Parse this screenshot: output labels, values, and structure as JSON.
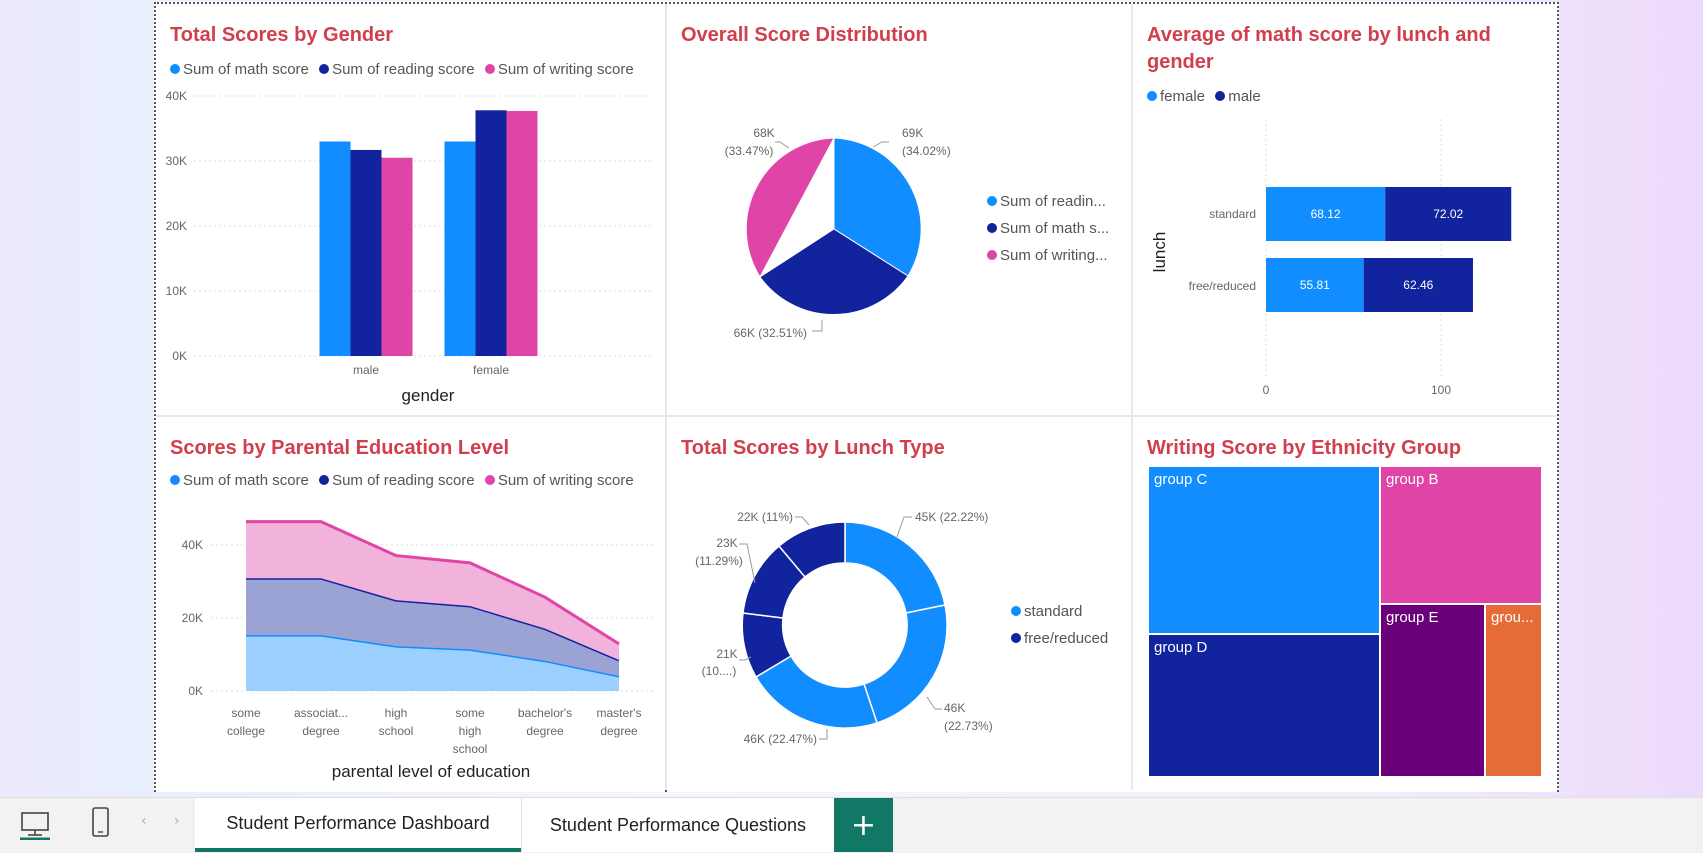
{
  "colors": {
    "light_blue": "#118DFF",
    "dark_blue": "#12239E",
    "pink": "#E044A7",
    "purple": "#6B007B",
    "orange": "#E66C37",
    "title_red": "#D13F4D",
    "tab_green": "#117865"
  },
  "panels": {
    "gender_scores": {
      "title": "Total Scores by Gender",
      "legend": [
        "Sum of math score",
        "Sum of reading score",
        "Sum of writing score"
      ],
      "xlabel": "gender",
      "yticks": [
        "40K",
        "30K",
        "20K",
        "10K",
        "0K"
      ],
      "chart_data": {
        "type": "bar",
        "categories": [
          "male",
          "female"
        ],
        "series": [
          {
            "name": "Sum of math score",
            "values": [
              33000,
              33000
            ]
          },
          {
            "name": "Sum of reading score",
            "values": [
              31700,
              37800
            ]
          },
          {
            "name": "Sum of writing score",
            "values": [
              30500,
              37700
            ]
          }
        ],
        "ylim": [
          0,
          40000
        ],
        "xlabel": "gender"
      }
    },
    "score_distribution": {
      "title": "Overall Score Distribution",
      "legend": [
        "Sum of readin...",
        "Sum of math s...",
        "Sum of writing..."
      ],
      "labels": {
        "a1": "69K",
        "a2": "(34.02%)",
        "b1": "66K (32.51%)",
        "c1": "68K",
        "c2": "(33.47%)"
      },
      "chart_data": {
        "type": "pie",
        "slices": [
          {
            "label": "Sum of readin...",
            "value": 69,
            "percent": 34.02
          },
          {
            "label": "Sum of math s...",
            "value": 66,
            "percent": 32.51
          },
          {
            "label": "Sum of writing...",
            "value": 68,
            "percent": 33.47
          }
        ]
      }
    },
    "lunch_gender_math": {
      "title_line1": "Average of math score by lunch and",
      "title_line2": "gender",
      "legend": [
        "female",
        "male"
      ],
      "ylabel": "lunch",
      "xticks": [
        "0",
        "100"
      ],
      "chart_data": {
        "type": "bar",
        "orientation": "horizontal",
        "stacked": true,
        "categories": [
          "standard",
          "free/reduced"
        ],
        "series": [
          {
            "name": "female",
            "values": [
              68.12,
              55.81
            ]
          },
          {
            "name": "male",
            "values": [
              72.02,
              62.46
            ]
          }
        ],
        "value_labels": [
          [
            "68.12",
            "55.81"
          ],
          [
            "72.02",
            "62.46"
          ]
        ],
        "ylabel": "lunch"
      }
    },
    "parental_education": {
      "title": "Scores by Parental Education Level",
      "legend": [
        "Sum of math score",
        "Sum of reading score",
        "Sum of writing score"
      ],
      "xlabel": "parental level of education",
      "yticks": [
        "40K",
        "20K",
        "0K"
      ],
      "xlabels": [
        [
          "some",
          "college"
        ],
        [
          "associat...",
          "degree"
        ],
        [
          "high",
          "school"
        ],
        [
          "some",
          "high",
          "school"
        ],
        [
          "bachelor's",
          "degree"
        ],
        [
          "master's",
          "degree"
        ]
      ],
      "chart_data": {
        "type": "area",
        "stacked": true,
        "categories": [
          "some college",
          "associat... degree",
          "high school",
          "some high school",
          "bachelor's degree",
          "master's degree"
        ],
        "series": [
          {
            "name": "Sum of math score",
            "values": [
              15300,
              15300,
              12300,
              11400,
              8300,
              4100
            ]
          },
          {
            "name": "Sum of reading score",
            "values": [
              15600,
              15600,
              12600,
              11900,
              8800,
              4400
            ]
          },
          {
            "name": "Sum of writing score",
            "values": [
              15500,
              15500,
              12200,
              11800,
              8600,
              4400
            ]
          }
        ],
        "ylim": [
          0,
          50000
        ],
        "xlabel": "parental level of education"
      }
    },
    "lunch_scores": {
      "title": "Total Scores by Lunch Type",
      "legend": [
        "standard",
        "free/reduced"
      ],
      "labels": {
        "s1": "45K (22.22%)",
        "s2a": "46K",
        "s2b": "(22.73%)",
        "s3": "46K (22.47%)",
        "f1a": "21K",
        "f1b": "(10....)",
        "f2a": "23K",
        "f2b": "(11.29%)",
        "f3": "22K (11%)"
      },
      "chart_data": {
        "type": "pie",
        "donut": true,
        "slices": [
          {
            "label": "standard",
            "value": 45,
            "percent": 22.22
          },
          {
            "label": "standard",
            "value": 46,
            "percent": 22.73
          },
          {
            "label": "standard",
            "value": 46,
            "percent": 22.47
          },
          {
            "label": "free/reduced",
            "value": 21
          },
          {
            "label": "free/reduced",
            "value": 23,
            "percent": 11.29
          },
          {
            "label": "free/reduced",
            "value": 22,
            "percent": 11
          }
        ]
      }
    },
    "ethnicity_writing": {
      "title": "Writing Score by Ethnicity Group",
      "tiles": [
        "group C",
        "group B",
        "group D",
        "group E",
        "grou..."
      ]
    }
  },
  "tabs": {
    "active": "Student Performance Dashboard",
    "other": "Student Performance Questions",
    "add": "+"
  }
}
